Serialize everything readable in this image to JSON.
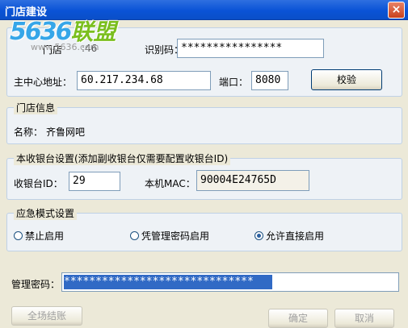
{
  "window": {
    "title": "门店建设",
    "close_glyph": "×"
  },
  "watermark": {
    "brand_num": "5636",
    "brand_cn": "联盟",
    "url": "www.5636.com"
  },
  "store": {
    "store_label": "门店",
    "store_value": ":46",
    "ident_label": "识别码：",
    "ident_value": "****************",
    "server_label": "主中心地址：",
    "server_value": "60.217.234.68",
    "port_label": "端口：",
    "port_value": "8080",
    "verify_button": "校验"
  },
  "store_info": {
    "title": "门店信息",
    "name_label": "名称：",
    "name_value": "齐鲁网吧"
  },
  "cashier": {
    "title": "本收银台设置(添加副收银台仅需要配置收银台ID)",
    "id_label": "收银台ID：",
    "id_value": "29",
    "mac_label": "本机MAC：",
    "mac_value": "90004E24765D"
  },
  "emergency": {
    "title": "应急模式设置",
    "options": [
      {
        "label": "禁止启用",
        "selected": false
      },
      {
        "label": "凭管理密码启用",
        "selected": false
      },
      {
        "label": "允许直接启用",
        "selected": true
      }
    ]
  },
  "admin": {
    "label": "管理密码：",
    "value": "******************************"
  },
  "footer": {
    "settle_button": "全场结账",
    "ok_button": "确定",
    "cancel_button": "取消"
  }
}
